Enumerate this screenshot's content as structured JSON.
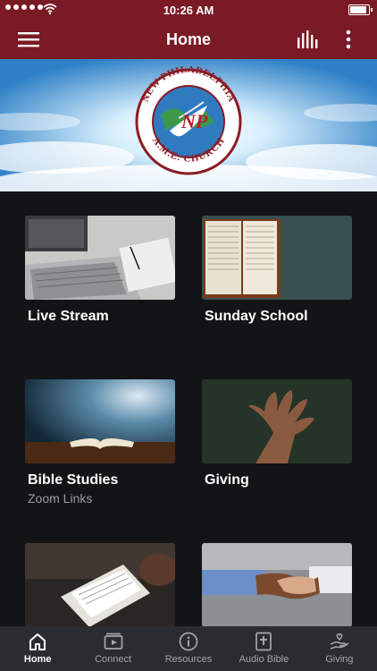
{
  "status_bar": {
    "time": "10:26 AM",
    "battery_level": 0.9
  },
  "app_bar": {
    "title": "Home",
    "menu_icon": "hamburger-menu-icon",
    "chart_icon": "bar-chart-icon",
    "more_icon": "more-vertical-icon"
  },
  "banner": {
    "logo": {
      "arc_top": "NEW PHILADELPHIA",
      "arc_bottom": "A.M.E. CHURCH",
      "monogram": "NP"
    }
  },
  "tiles": [
    {
      "label": "Live Stream",
      "sub": "",
      "image": "laptop-photo"
    },
    {
      "label": "Sunday School",
      "sub": "",
      "image": "open-bible-photo"
    },
    {
      "label": "Bible Studies",
      "sub": "Zoom Links",
      "image": "glowing-book-photo"
    },
    {
      "label": "Giving",
      "sub": "",
      "image": "open-hand-photo"
    },
    {
      "label": "",
      "sub": "",
      "image": "bible-reading-photo"
    },
    {
      "label": "",
      "sub": "",
      "image": "handshake-photo"
    }
  ],
  "tabbar": [
    {
      "label": "Home",
      "icon": "home-icon",
      "active": true
    },
    {
      "label": "Connect",
      "icon": "video-icon",
      "active": false
    },
    {
      "label": "Resources",
      "icon": "info-icon",
      "active": false
    },
    {
      "label": "Audio Bible",
      "icon": "bible-icon",
      "active": false
    },
    {
      "label": "Giving",
      "icon": "giving-hand-icon",
      "active": false
    }
  ],
  "colors": {
    "brand": "#7a1a25",
    "background": "#131416",
    "tabbar": "#2a2c30"
  }
}
